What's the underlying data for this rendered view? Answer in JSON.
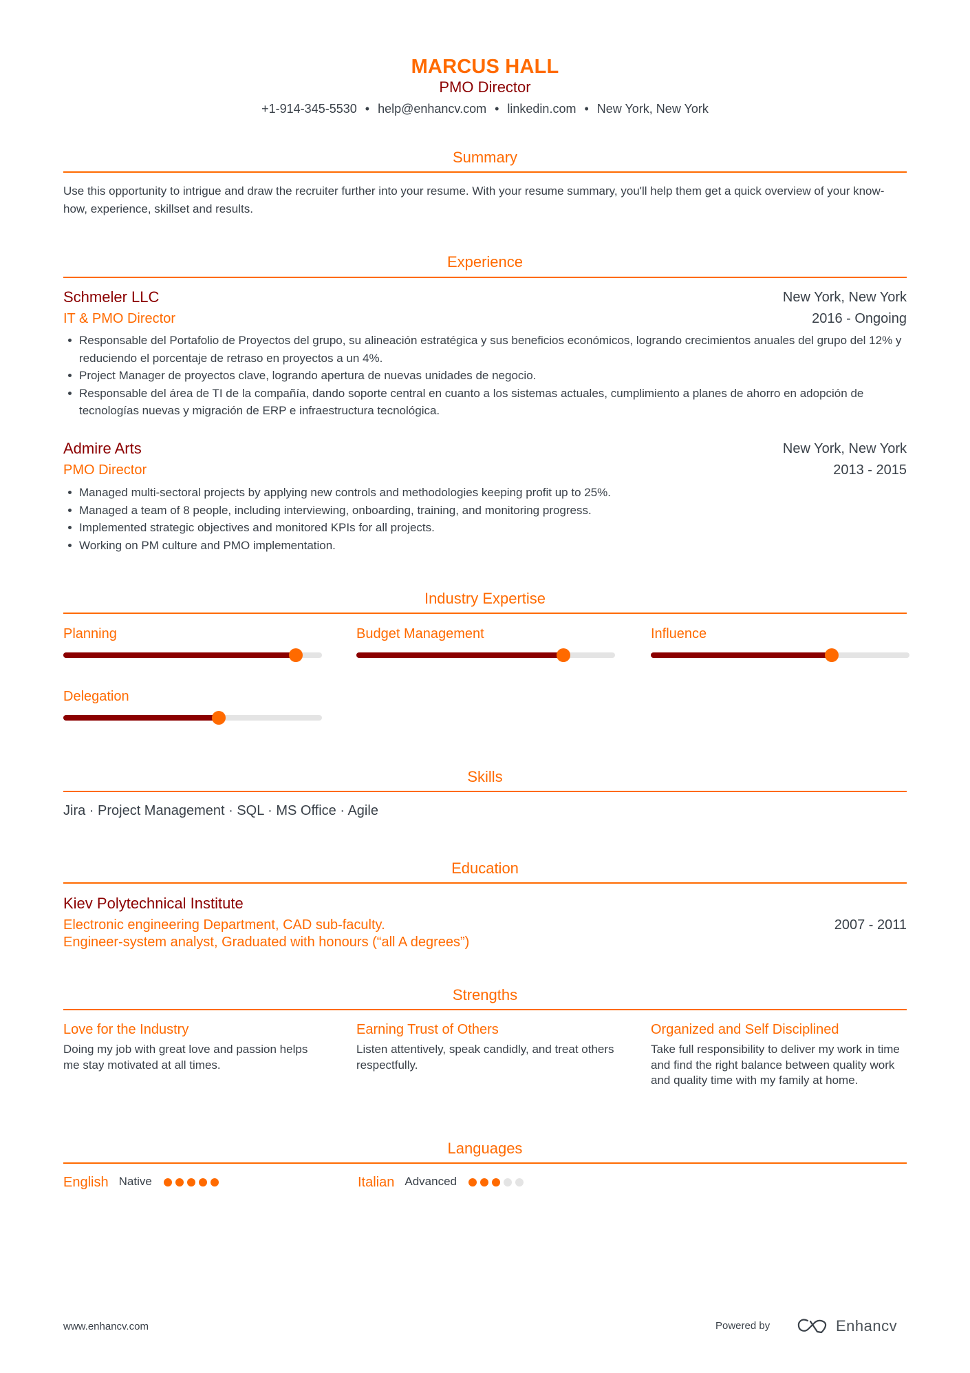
{
  "header": {
    "name": "MARCUS HALL",
    "title": "PMO Director",
    "contact": [
      "+1-914-345-5530",
      "help@enhancv.com",
      "linkedin.com",
      "New York, New York"
    ],
    "separator": "•"
  },
  "summary": {
    "heading": "Summary",
    "text": "Use this opportunity to intrigue and draw the recruiter further into your resume. With your resume summary, you'll help them get a quick overview of your know-how, experience, skillset and results."
  },
  "experience": {
    "heading": "Experience",
    "items": [
      {
        "company": "Schmeler LLC",
        "role": "IT & PMO Director",
        "location": "New York, New York",
        "dates": "2016 - Ongoing",
        "bullets": [
          "Responsable del Portafolio de Proyectos del grupo, su alineación estratégica y sus beneficios económicos, logrando crecimientos anuales del grupo del 12% y reduciendo el porcentaje de retraso en proyectos a un 4%.",
          "Project Manager de proyectos clave, logrando apertura de nuevas unidades de negocio.",
          "Responsable del área de TI de la compañía, dando soporte central en cuanto a los sistemas actuales, cumplimiento a planes de ahorro en adopción de tecnologías nuevas y migración de ERP e infraestructura tecnológica."
        ]
      },
      {
        "company": "Admire Arts",
        "role": "PMO Director",
        "location": "New York, New York",
        "dates": "2013 - 2015",
        "bullets": [
          "Managed multi-sectoral projects by applying new controls and methodologies keeping profit up to 25%.",
          "Managed a team of 8 people, including interviewing, onboarding, training, and monitoring progress.",
          "Implemented strategic objectives and monitored KPIs for all projects.",
          "Working on PM culture and PMO implementation."
        ]
      }
    ]
  },
  "expertise": {
    "heading": "Industry Expertise",
    "items": [
      {
        "label": "Planning",
        "level": 0.9
      },
      {
        "label": "Budget Management",
        "level": 0.8
      },
      {
        "label": "Influence",
        "level": 0.7
      },
      {
        "label": "Delegation",
        "level": 0.6
      }
    ]
  },
  "skills": {
    "heading": "Skills",
    "text": "Jira · Project Management · SQL · MS Office · Agile"
  },
  "education": {
    "heading": "Education",
    "school": "Kiev Polytechnical Institute",
    "line1": "Electronic engineering Department, CAD sub-faculty.",
    "line2": "Engineer-system analyst, Graduated with honours (“all A degrees”)",
    "dates": "2007 - 2011"
  },
  "strengths": {
    "heading": "Strengths",
    "items": [
      {
        "title": "Love for the Industry",
        "desc": "Doing my job with great love and passion helps me stay motivated at all times."
      },
      {
        "title": "Earning Trust of Others",
        "desc": "Listen attentively, speak candidly, and treat others respectfully."
      },
      {
        "title": "Organized and Self Disciplined",
        "desc": "Take full responsibility to deliver my work in time and find the right balance between quality work and quality time with my family at home."
      }
    ]
  },
  "languages": {
    "heading": "Languages",
    "items": [
      {
        "name": "English",
        "level": "Native",
        "dots": 5,
        "max": 5
      },
      {
        "name": "Italian",
        "level": "Advanced",
        "dots": 3,
        "max": 5
      }
    ]
  },
  "footer": {
    "website": "www.enhancv.com",
    "powered_by": "Powered by",
    "brand": "Enhancv"
  },
  "colors": {
    "accent": "#ff6a00",
    "dark_red": "#8b0000",
    "text": "#3a4149",
    "track": "#e4e4e4"
  }
}
